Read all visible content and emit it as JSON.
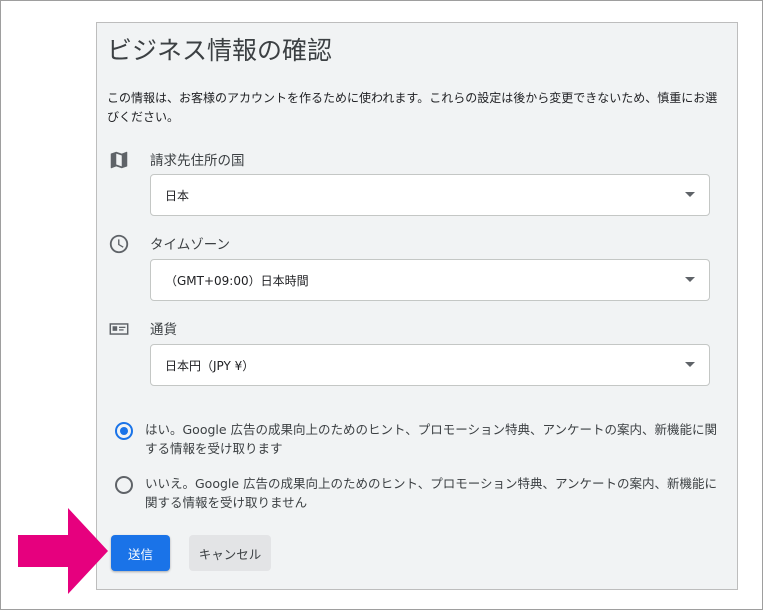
{
  "page": {
    "title": "ビジネス情報の確認",
    "description": "この情報は、お客様のアカウントを作るために使われます。これらの設定は後から変更できないため、慎重にお選びください。"
  },
  "fields": {
    "billing_country": {
      "label": "請求先住所の国",
      "value": "日本",
      "icon": "map-icon"
    },
    "time_zone": {
      "label": "タイムゾーン",
      "value": "（GMT+09:00）日本時間",
      "icon": "clock-icon"
    },
    "currency": {
      "label": "通貨",
      "value": "日本円（JPY ¥）",
      "icon": "currency-icon"
    }
  },
  "options": {
    "yes": {
      "text": "はい。Google 広告の成果向上のためのヒント、プロモーション特典、アンケートの案内、新機能に関する情報を受け取ります",
      "selected": true
    },
    "no": {
      "text": "いいえ。Google 広告の成果向上のためのヒント、プロモーション特典、アンケートの案内、新機能に関する情報を受け取りません",
      "selected": false
    }
  },
  "buttons": {
    "submit": "送信",
    "cancel": "キャンセル"
  },
  "colors": {
    "primary": "#1a73e8",
    "annotation_arrow": "#e6007e",
    "panel_background": "#f1f3f4"
  }
}
